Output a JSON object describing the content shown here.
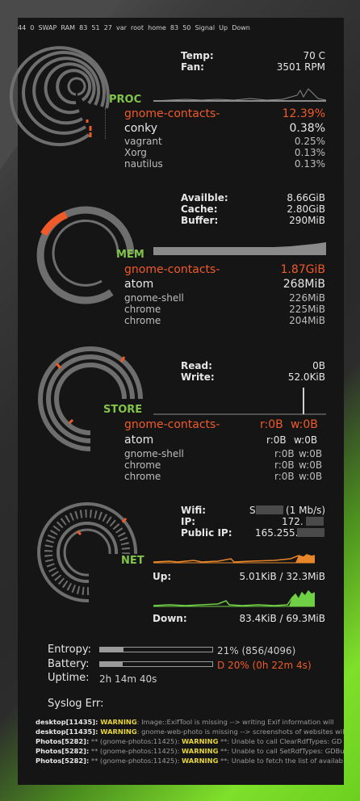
{
  "proc": {
    "section": "PROC",
    "temp_label": "Temp:",
    "temp_value": "70 C",
    "fan_label": "Fan:",
    "fan_value": "3501 RPM",
    "top": [
      {
        "name": "gnome-contacts-",
        "value": "12.39%"
      },
      {
        "name": "conky",
        "value": "0.38%"
      },
      {
        "name": "vagrant",
        "value": "0.25%"
      },
      {
        "name": "Xorg",
        "value": "0.13%"
      },
      {
        "name": "nautilus",
        "value": "0.13%"
      }
    ]
  },
  "mem": {
    "section": "MEM",
    "available_label": "Availble:",
    "available_value": "8.66GiB",
    "cache_label": "Cache:",
    "cache_value": "2.80GiB",
    "buffer_label": "Buffer:",
    "buffer_value": "290MiB",
    "ring_labels": {
      "ram_pct": "44",
      "swap_pct": "0",
      "swap": "SWAP",
      "ram": "RAM"
    },
    "top": [
      {
        "name": "gnome-contacts-",
        "value": "1.87GiB"
      },
      {
        "name": "atom",
        "value": "268MiB"
      },
      {
        "name": "gnome-shell",
        "value": "226MiB"
      },
      {
        "name": "chrome",
        "value": "225MiB"
      },
      {
        "name": "chrome",
        "value": "204MiB"
      }
    ]
  },
  "store": {
    "section": "STORE",
    "read_label": "Read:",
    "read_value": "0B",
    "write_label": "Write:",
    "write_value": "52.0KiB",
    "ring_labels": {
      "var_pct": "83",
      "root_pct": "51",
      "home_pct": "27",
      "var": "var",
      "root": "root",
      "home": "home"
    },
    "top": [
      {
        "name": "gnome-contacts-",
        "read": "r:0B",
        "write": "w:0B"
      },
      {
        "name": "atom",
        "read": "r:0B",
        "write": "w:0B"
      },
      {
        "name": "gnome-shell",
        "read": "r:0B",
        "write": "w:0B"
      },
      {
        "name": "chrome",
        "read": "r:0B",
        "write": "w:0B"
      },
      {
        "name": "chrome",
        "read": "r:0B",
        "write": "w:0B"
      }
    ]
  },
  "net": {
    "section": "NET",
    "wifi_label": "Wifi:",
    "wifi_value_prefix": "S",
    "wifi_value_suffix": "(1 Mb/s)",
    "ip_label": "IP:",
    "ip_value": "172.",
    "public_ip_label": "Public IP:",
    "public_ip_value": "165.255.",
    "ring_labels": {
      "signal_pct": "83",
      "up_pct": "50",
      "signal": "Signal",
      "up": "Up",
      "down": "Down"
    },
    "up_label": "Up:",
    "up_value": "5.01KiB / 32.3MiB",
    "down_label": "Down:",
    "down_value": "83.4KiB / 69.3MiB"
  },
  "status": {
    "entropy_label": "Entropy:",
    "entropy_value": "21% (856/4096)",
    "entropy_fraction": 0.21,
    "battery_label": "Battery:",
    "battery_value": "D 20% (0h 22m 4s)",
    "battery_fraction": 0.2,
    "uptime_label": "Uptime:",
    "uptime_value": "2h 14m 40s"
  },
  "syslog": {
    "title": "Syslog Err:",
    "lines": [
      {
        "source": "desktop[11435]:",
        "level": "WARNING",
        "message": ": Image::ExifTool is missing --> writing Exif information will"
      },
      {
        "source": "desktop[11435]:",
        "level": "WARNING",
        "message": ": gnome-web-photo is missing --> screenshots of websites wil"
      },
      {
        "source": "Photos[5282]:",
        "pre": " ** (gnome-photos:11425): ",
        "level": "WARNING",
        "message": " **: Unable to call ClearRdfTypes: GD"
      },
      {
        "source": "Photos[5282]:",
        "pre": " ** (gnome-photos:11425): ",
        "level": "WARNING",
        "message": " **: Unable to call SetRdfTypes: GDBu"
      },
      {
        "source": "Photos[5282]:",
        "pre": " ** (gnome-photos:11425): ",
        "level": "WARNING",
        "message": " **: Unable to fetch the list of availab"
      }
    ]
  },
  "colors": {
    "accent": "#f05a28",
    "section": "#82c34a",
    "ring": "#6e6e6e",
    "graph_up": "#e8862a",
    "graph_down": "#6fcf45"
  }
}
